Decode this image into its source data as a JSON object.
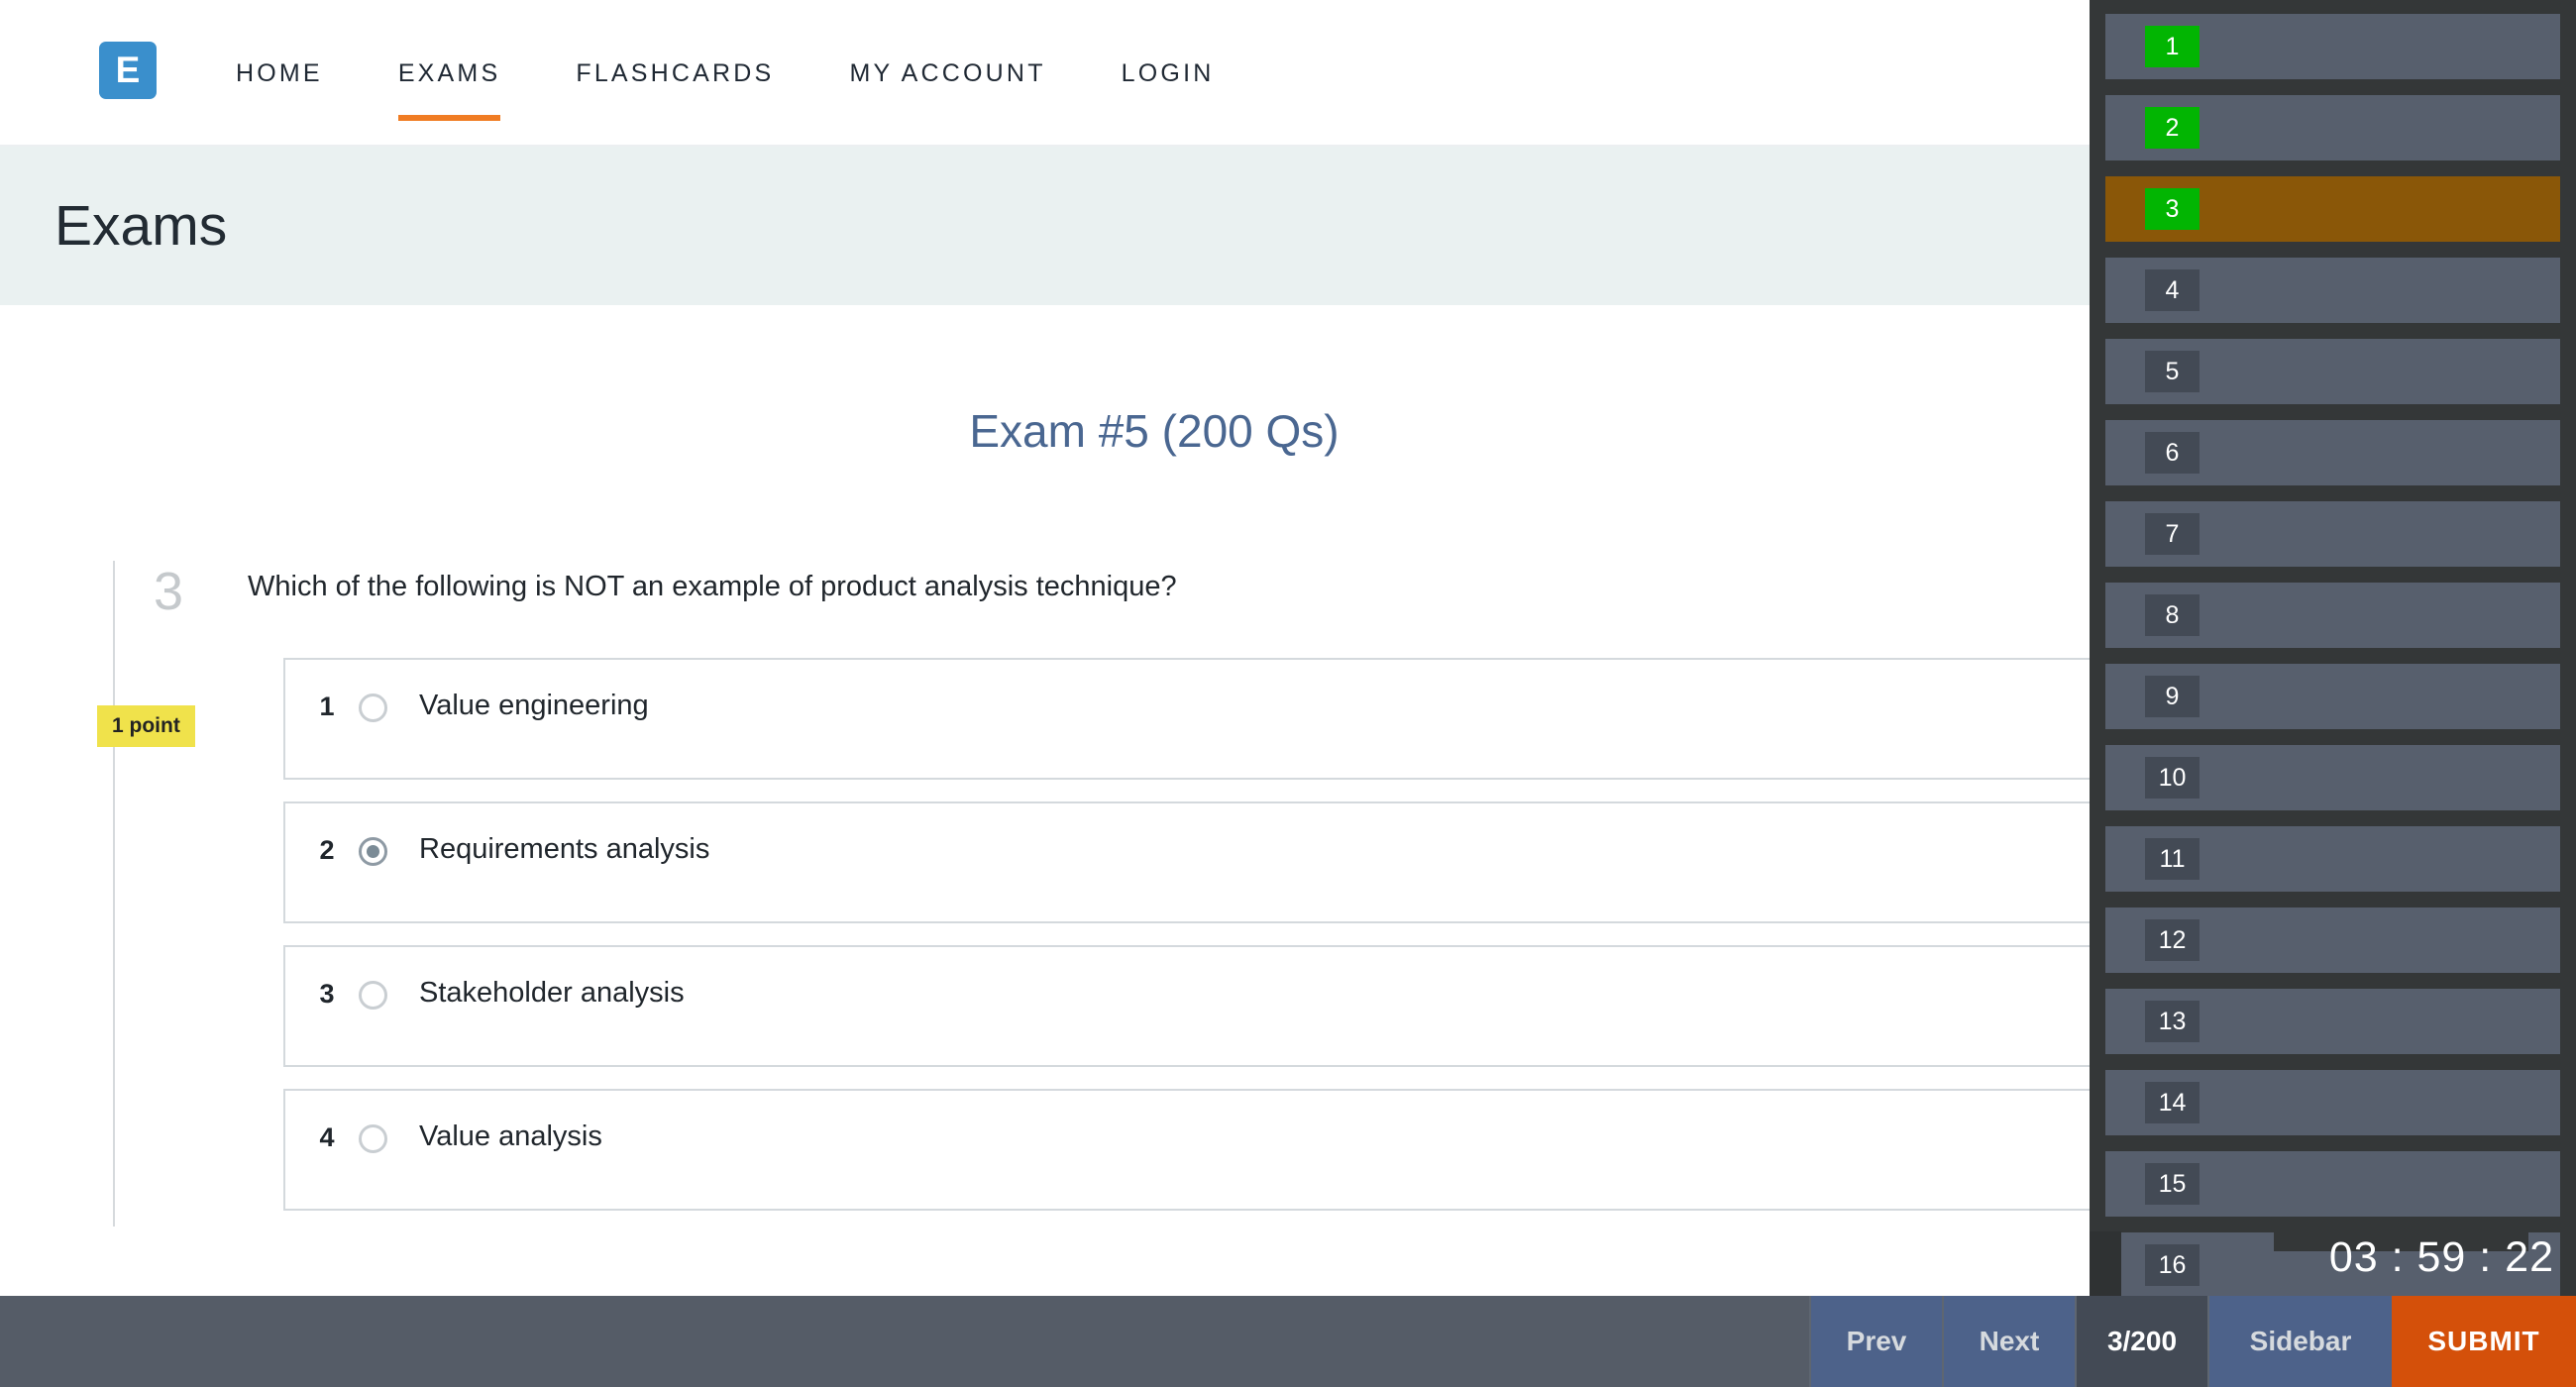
{
  "nav": {
    "logo_letter": "E",
    "links": [
      {
        "label": "HOME",
        "active": false
      },
      {
        "label": "EXAMS",
        "active": true
      },
      {
        "label": "FLASHCARDS",
        "active": false
      },
      {
        "label": "MY ACCOUNT",
        "active": false
      },
      {
        "label": "LOGIN",
        "active": false
      }
    ]
  },
  "banner": {
    "title": "Exams"
  },
  "exam": {
    "title": "Exam #5 (200 Qs)",
    "question_number": "3",
    "points_label": "1 point",
    "question_text": "Which of the following is NOT an example of product analysis technique?",
    "options": [
      {
        "index": "1",
        "label": "Value engineering",
        "selected": false
      },
      {
        "index": "2",
        "label": "Requirements analysis",
        "selected": true
      },
      {
        "index": "3",
        "label": "Stakeholder analysis",
        "selected": false
      },
      {
        "index": "4",
        "label": "Value analysis",
        "selected": false
      }
    ]
  },
  "sidebar": {
    "items": [
      {
        "number": "1",
        "answered": true,
        "current": false
      },
      {
        "number": "2",
        "answered": true,
        "current": false
      },
      {
        "number": "3",
        "answered": true,
        "current": true
      },
      {
        "number": "4",
        "answered": false,
        "current": false
      },
      {
        "number": "5",
        "answered": false,
        "current": false
      },
      {
        "number": "6",
        "answered": false,
        "current": false
      },
      {
        "number": "7",
        "answered": false,
        "current": false
      },
      {
        "number": "8",
        "answered": false,
        "current": false
      },
      {
        "number": "9",
        "answered": false,
        "current": false
      },
      {
        "number": "10",
        "answered": false,
        "current": false
      },
      {
        "number": "11",
        "answered": false,
        "current": false
      },
      {
        "number": "12",
        "answered": false,
        "current": false
      },
      {
        "number": "13",
        "answered": false,
        "current": false
      },
      {
        "number": "14",
        "answered": false,
        "current": false
      },
      {
        "number": "15",
        "answered": false,
        "current": false
      },
      {
        "number": "16",
        "answered": false,
        "current": false
      }
    ],
    "timer": "03 : 59 : 22"
  },
  "toolbar": {
    "prev_label": "Prev",
    "next_label": "Next",
    "counter_label": "3/200",
    "sidebar_label": "Sidebar",
    "submit_label": "SUBMIT"
  },
  "colors": {
    "brand_blue": "#3a8fcc",
    "accent_orange": "#f07c23",
    "answered_green": "#02b502",
    "current_brown": "#8a5708",
    "submit_orange": "#d4500a",
    "point_yellow": "#f0e24b",
    "title_blue": "#4a6791"
  }
}
